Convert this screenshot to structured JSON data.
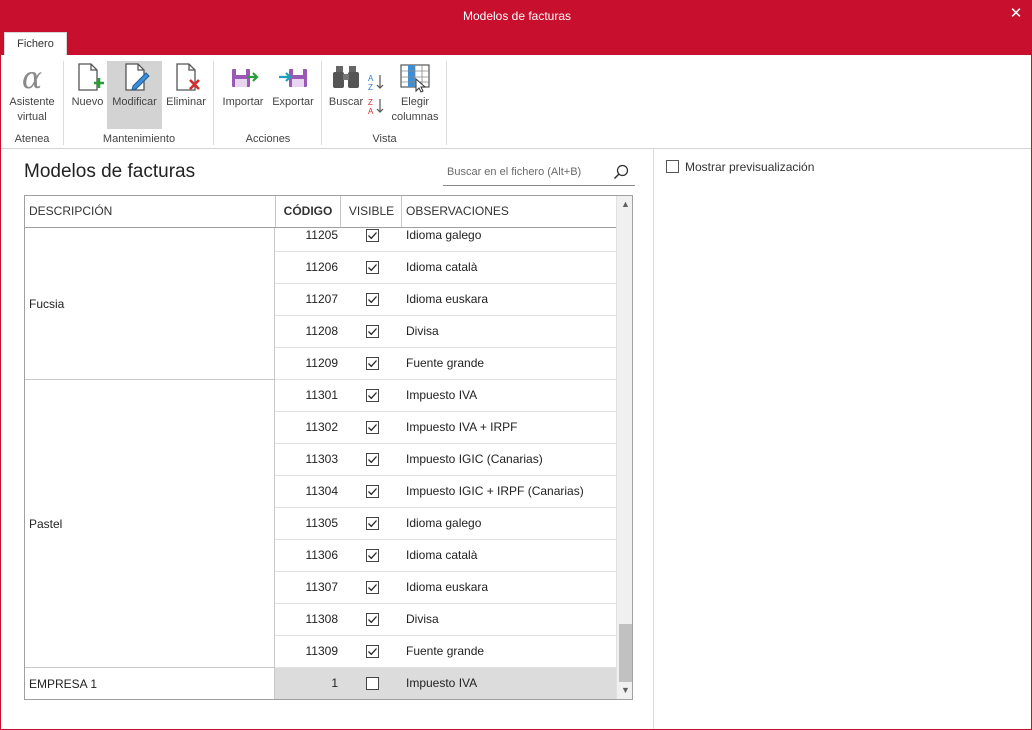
{
  "window": {
    "title": "Modelos de facturas",
    "close_glyph": "✕"
  },
  "tabs": [
    {
      "label": "Fichero"
    }
  ],
  "ribbon": {
    "buttons": {
      "asistente": {
        "line1": "Asistente",
        "line2": "virtual",
        "icon": "alpha-icon"
      },
      "nuevo": {
        "label": "Nuevo",
        "icon": "new-document-icon"
      },
      "modificar": {
        "label": "Modificar",
        "icon": "edit-document-icon"
      },
      "eliminar": {
        "label": "Eliminar",
        "icon": "delete-document-icon"
      },
      "importar": {
        "label": "Importar",
        "icon": "import-icon"
      },
      "exportar": {
        "label": "Exportar",
        "icon": "export-icon"
      },
      "buscar": {
        "label": "Buscar",
        "icon": "binoculars-icon"
      },
      "elegir": {
        "line1": "Elegir",
        "line2": "columnas",
        "icon": "columns-icon"
      }
    },
    "groups": {
      "atenea": "Atenea",
      "mantenimiento": "Mantenimiento",
      "acciones": "Acciones",
      "vista": "Vista"
    }
  },
  "page_title": "Modelos de facturas",
  "search": {
    "placeholder": "Buscar en el fichero (Alt+B)"
  },
  "preview": {
    "label": "Mostrar previsualización",
    "checked": false
  },
  "grid": {
    "columns": {
      "descripcion": "DESCRIPCIÓN",
      "codigo": "CÓDIGO",
      "visible": "VISIBLE",
      "observaciones": "OBSERVACIONES"
    },
    "groups": [
      "Fucsia",
      "Pastel",
      "EMPRESA 1"
    ],
    "rows": [
      {
        "code": "11205",
        "visible": true,
        "obs": "Idioma galego"
      },
      {
        "code": "11206",
        "visible": true,
        "obs": "Idioma català"
      },
      {
        "code": "11207",
        "visible": true,
        "obs": "Idioma euskara"
      },
      {
        "code": "11208",
        "visible": true,
        "obs": "Divisa"
      },
      {
        "code": "11209",
        "visible": true,
        "obs": "Fuente grande"
      },
      {
        "code": "11301",
        "visible": true,
        "obs": "Impuesto IVA"
      },
      {
        "code": "11302",
        "visible": true,
        "obs": "Impuesto IVA + IRPF"
      },
      {
        "code": "11303",
        "visible": true,
        "obs": "Impuesto IGIC (Canarias)"
      },
      {
        "code": "11304",
        "visible": true,
        "obs": "Impuesto IGIC + IRPF (Canarias)"
      },
      {
        "code": "11305",
        "visible": true,
        "obs": "Idioma galego"
      },
      {
        "code": "11306",
        "visible": true,
        "obs": "Idioma català"
      },
      {
        "code": "11307",
        "visible": true,
        "obs": "Idioma euskara"
      },
      {
        "code": "11308",
        "visible": true,
        "obs": "Divisa"
      },
      {
        "code": "11309",
        "visible": true,
        "obs": "Fuente grande"
      },
      {
        "code": "1",
        "visible": false,
        "obs": "Impuesto IVA",
        "selected": true
      }
    ]
  },
  "colors": {
    "brand": "#c8102e",
    "selection": "#dcdcdc"
  }
}
